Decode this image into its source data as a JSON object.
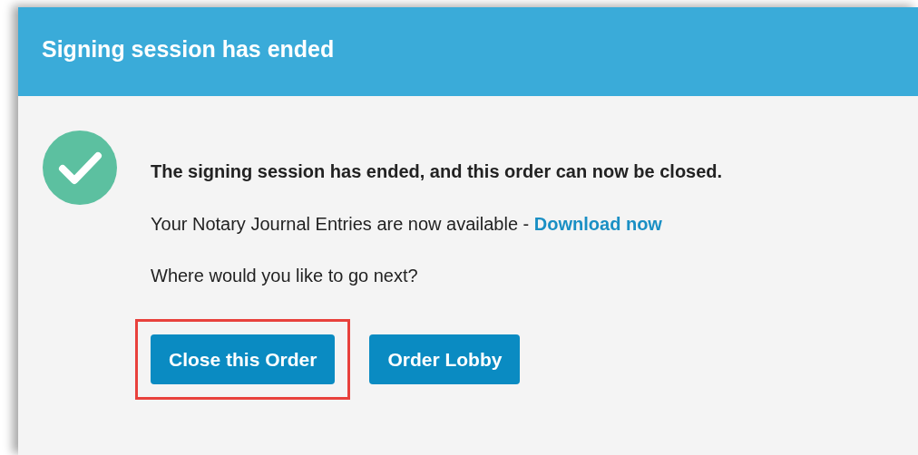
{
  "dialog": {
    "title": "Signing session has ended",
    "status": {
      "kind": "success"
    },
    "message": "The signing session has ended, and this order can now be closed.",
    "journal": {
      "text": "Your Notary Journal Entries are now available -",
      "link": "Download now"
    },
    "prompt": "Where would you like to go next?",
    "buttons": [
      {
        "label": "Close this Order",
        "highlighted": true
      },
      {
        "label": "Order Lobby",
        "highlighted": false
      }
    ]
  }
}
